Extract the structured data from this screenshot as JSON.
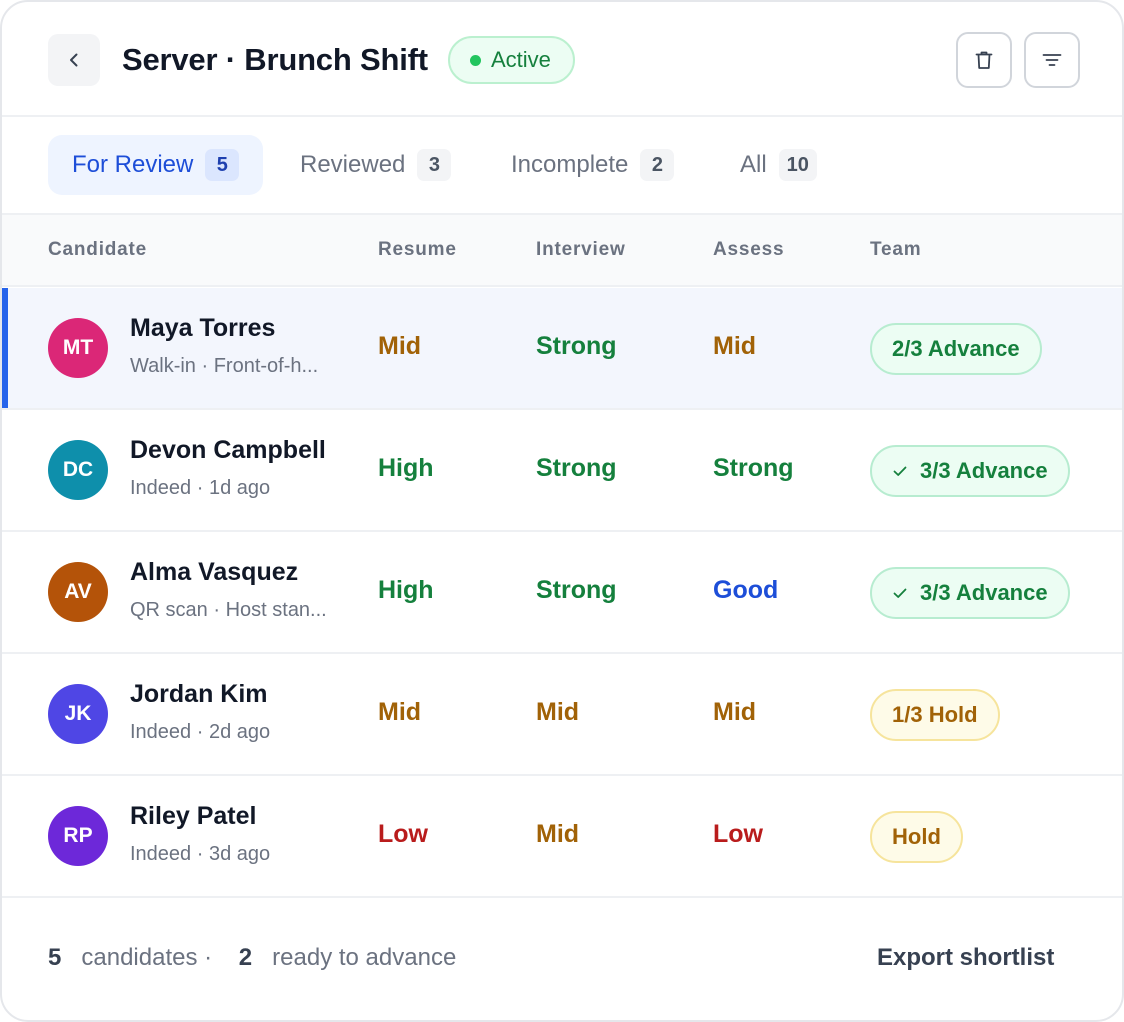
{
  "header": {
    "title": "Server · Brunch Shift",
    "status": "Active",
    "icons": {
      "back": "chevron-left-icon",
      "delete": "trash-icon",
      "filter": "filter-icon"
    }
  },
  "tabs": [
    {
      "label": "For Review",
      "count": "5",
      "active": true
    },
    {
      "label": "Reviewed",
      "count": "3",
      "active": false
    },
    {
      "label": "Incomplete",
      "count": "2",
      "active": false
    },
    {
      "label": "All",
      "count": "10",
      "active": false
    }
  ],
  "columns": {
    "candidate": "Candidate",
    "resume": "Resume",
    "interview": "Interview",
    "assess": "Assess",
    "team": "Team"
  },
  "rows": [
    {
      "initials": "MT",
      "avatar_color": "#db2777",
      "name": "Maya Torres",
      "meta": "Walk-in · Front-of-h...",
      "resume": "Mid",
      "interview": "Strong",
      "assess": "Mid",
      "team": "2/3 Advance",
      "team_check": false
    },
    {
      "initials": "DC",
      "avatar_color": "#0e8fab",
      "name": "Devon Campbell",
      "meta": "Indeed · 1d ago",
      "resume": "High",
      "interview": "Strong",
      "assess": "Strong",
      "team": "3/3 Advance",
      "team_check": true
    },
    {
      "initials": "AV",
      "avatar_color": "#b45309",
      "name": "Alma Vasquez",
      "meta": "QR scan · Host stan...",
      "resume": "High",
      "interview": "Strong",
      "assess": "Good",
      "team": "3/3 Advance",
      "team_check": true
    },
    {
      "initials": "JK",
      "avatar_color": "#4f46e5",
      "name": "Jordan Kim",
      "meta": "Indeed · 2d ago",
      "resume": "Mid",
      "interview": "Mid",
      "assess": "Mid",
      "team": "1/3 Hold",
      "team_check": false
    },
    {
      "initials": "RP",
      "avatar_color": "#6d28d9",
      "name": "Riley Patel",
      "meta": "Indeed · 3d ago",
      "resume": "Low",
      "interview": "Mid",
      "assess": "Low",
      "team": "Hold",
      "team_check": false
    }
  ],
  "footer": {
    "candidates_count": "5",
    "candidates_label": "candidates ·",
    "ready_count": "2",
    "ready_label": "ready to advance",
    "export_label": "Export shortlist"
  },
  "colors": {
    "accent": "#2563eb",
    "success": "#15803d",
    "warning": "#a16207",
    "danger": "#b91c1c",
    "info": "#1d4ed8"
  }
}
